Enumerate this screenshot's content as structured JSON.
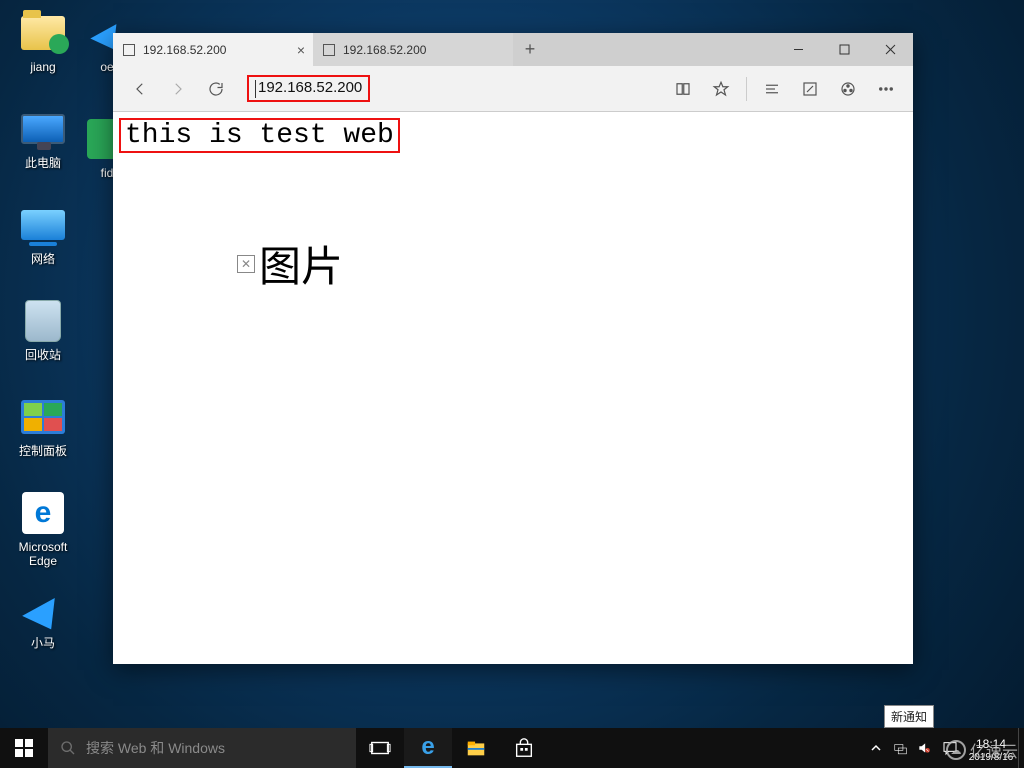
{
  "desktop": {
    "icons": [
      {
        "label": "jiang",
        "glyph": "folder-user"
      },
      {
        "label": "此电脑",
        "glyph": "pc"
      },
      {
        "label": "网络",
        "glyph": "net"
      },
      {
        "label": "回收站",
        "glyph": "bin"
      },
      {
        "label": "控制面板",
        "glyph": "cp"
      },
      {
        "label": "Microsoft\nEdge",
        "glyph": "edge"
      },
      {
        "label": "小马",
        "glyph": "plane"
      }
    ],
    "icons_col2": [
      {
        "label": "oe",
        "glyph": "plane"
      },
      {
        "label": "fid",
        "glyph": "fid"
      }
    ]
  },
  "browser": {
    "tabs": [
      {
        "title": "192.168.52.200",
        "active": true
      },
      {
        "title": "192.168.52.200",
        "active": false
      }
    ],
    "address": "192.168.52.200",
    "page": {
      "heading": "this is test web",
      "image_alt": "图片"
    }
  },
  "taskbar": {
    "search_placeholder": "搜索 Web 和 Windows",
    "tooltip": "新通知",
    "clock_time": "18:14",
    "clock_date": "2019/8/16"
  },
  "watermark": "亿速云"
}
